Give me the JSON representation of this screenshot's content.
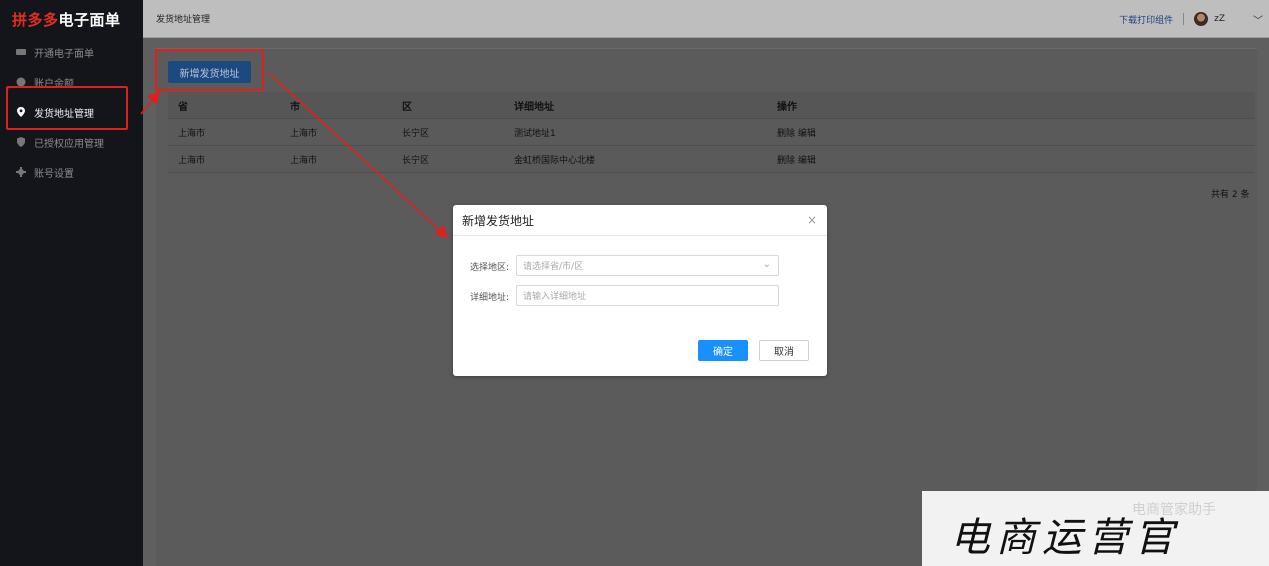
{
  "brand": {
    "pdd": "拼多多",
    "rest": "电子面单"
  },
  "sidebar": {
    "items": [
      {
        "label": "开通电子面单",
        "icon": "card-icon"
      },
      {
        "label": "账户余额",
        "icon": "coin-icon"
      },
      {
        "label": "发货地址管理",
        "icon": "location-pin-icon",
        "active": true
      },
      {
        "label": "已授权应用管理",
        "icon": "shield-icon"
      },
      {
        "label": "账号设置",
        "icon": "gear-icon"
      }
    ]
  },
  "header": {
    "breadcrumb": "发货地址管理",
    "download_link": "下载打印组件",
    "username": "zZ"
  },
  "main": {
    "add_button": "新增发货地址",
    "table": {
      "columns": [
        "省",
        "市",
        "区",
        "详细地址",
        "操作"
      ],
      "rows": [
        {
          "province": "上海市",
          "city": "上海市",
          "district": "长宁区",
          "address": "测试地址1",
          "delete": "删除",
          "edit": "编辑"
        },
        {
          "province": "上海市",
          "city": "上海市",
          "district": "长宁区",
          "address": "金虹桥国际中心北楼",
          "delete": "删除",
          "edit": "编辑"
        }
      ]
    },
    "total": "共有 2 条"
  },
  "modal": {
    "title": "新增发货地址",
    "region_label": "选择地区:",
    "region_placeholder": "请选择省/市/区",
    "address_label": "详细地址:",
    "address_placeholder": "请输入详细地址",
    "confirm": "确定",
    "cancel": "取消"
  },
  "watermark": {
    "text": "电商运营官",
    "small": "电商管家助手"
  },
  "colors": {
    "highlight_red": "#e0201c",
    "primary_blue": "#1890ff",
    "brand_red": "#e02e24"
  }
}
